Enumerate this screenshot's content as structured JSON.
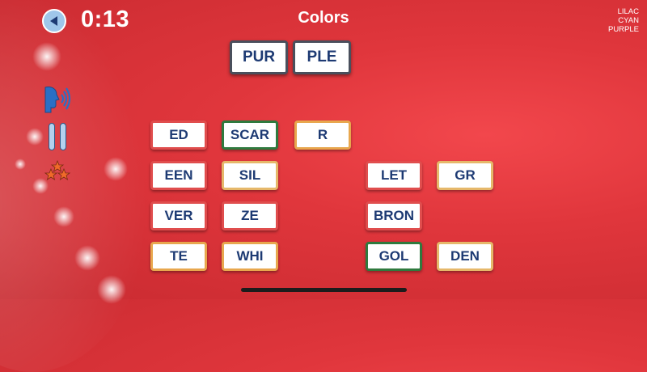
{
  "header": {
    "timer": "0:13",
    "category": "Colors",
    "hint_words": [
      "LILAC",
      "CYAN",
      "PURPLE"
    ]
  },
  "icons": {
    "back": "back-arrow-icon",
    "speaker": "speaker-icon",
    "pause": "pause-icon",
    "stars": "stars-icon"
  },
  "answer_tiles": [
    "PUR",
    "PLE"
  ],
  "letter_tiles": [
    "ED",
    "SCAR",
    "R",
    "EEN",
    "SIL",
    "LET",
    "GR",
    "VER",
    "ZE",
    "BRON",
    "TE",
    "WHI",
    "GOL",
    "DEN"
  ],
  "colors": {
    "background": "#e0363c",
    "tile_text": "#1d3a73",
    "border_green": "#2f7a3e",
    "border_orange": "#e8a74e",
    "border_red": "#e04d4d"
  }
}
